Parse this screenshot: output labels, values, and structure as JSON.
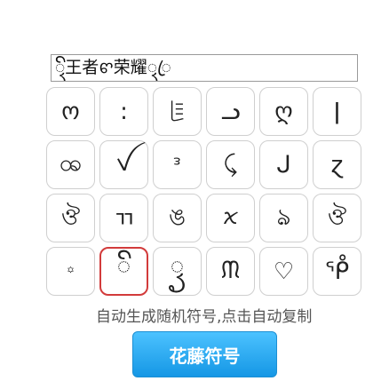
{
  "name_display": {
    "value": "ꦽꦼ王者ꨓ荣耀ꦽꦿ"
  },
  "symbols": [
    "ო",
    "꞉",
    "ꇸ",
    "ᓗ",
    "ღ",
    "ǀ",
    "ꩪ",
    "ꪜ",
    "ᵌ",
    "⤹",
    "ᒍ",
    "ɀ",
    "ঔ",
    "ㄲ",
    "ঙ",
    "ꪎ",
    "ঌ",
    "ঔ",
    "꙳",
    "ꦼ",
    "ꦽ",
    "ᙏ",
    "♡",
    "ᕾ"
  ],
  "caption": "自动生成随机符号,点击自动复制",
  "button_label": "花藤符号",
  "colors": {
    "accent": "#1597e5",
    "selected_border": "#d23b3b"
  }
}
